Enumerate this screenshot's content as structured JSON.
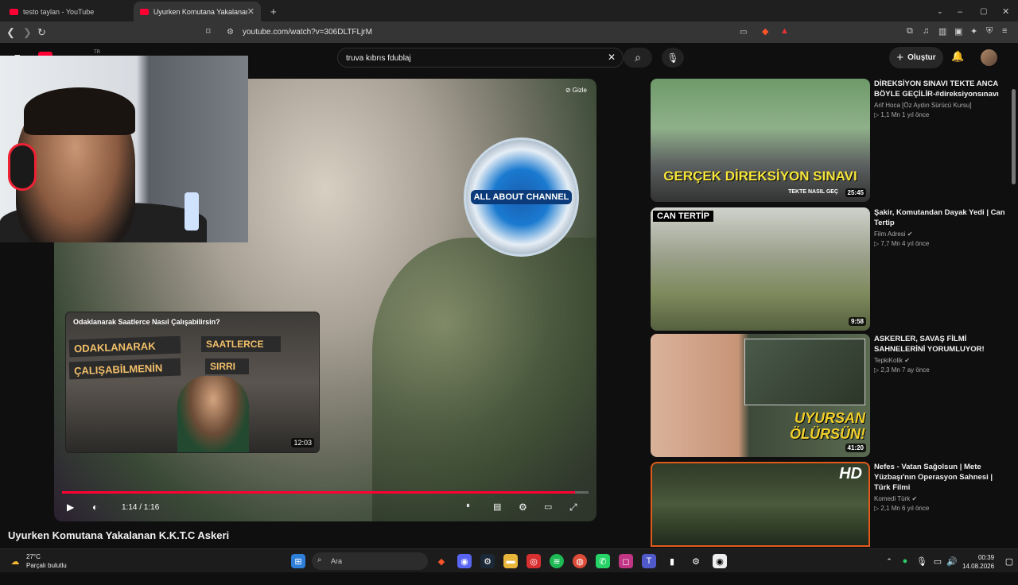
{
  "browser": {
    "tabs": [
      {
        "label": "testo taylan - YouTube"
      },
      {
        "label": "Uyurken Komutana Yakalanan K"
      }
    ],
    "new_tab_icon": "plus-icon",
    "url": "youtube.com/watch?v=306DLTFLjrM"
  },
  "header": {
    "search_value": "truva kıbrıs fdublaj",
    "create_label": "Oluştur",
    "logo_badge": "TR"
  },
  "player": {
    "hide_label": "Gizle",
    "channel_logo_text": "ALL ABOUT CHANNEL",
    "time": "1:14 / 1:16",
    "progress_fraction": 0.974,
    "endcard": {
      "title": "Odaklanarak Saatlerce Nasıl Çalışabilirsin?",
      "duration": "12:03",
      "overlay_lines": [
        "ODAKLANARAK",
        "ÇALIŞABİLMENİN",
        "SAATLERCE",
        "SIRRI"
      ]
    }
  },
  "video_title": "Uyurken Komutana Yakalanan K.K.T.C Askeri",
  "recommendations": [
    {
      "title": "DİREKSİYON SINAVI TEKTE ANCA BÖYLE GEÇİLİR-#direksiyonsınavı",
      "channel": "Arif Hoca [Öz Aydın Sürücü Kursu]",
      "stats": "▷ 1,1 Mn   1 yıl önce",
      "duration": "25:45",
      "overlay": "GERÇEK DİREKSİYON SINAVI",
      "overlay_sub": "TEKTE NASIL GEÇ"
    },
    {
      "title": "Şakir, Komutandan Dayak Yedi | Can Tertip",
      "channel": "Film Adresi",
      "stats": "▷ 7,7 Mn   4 yıl önce",
      "duration": "9:58",
      "overlay": "CAN TERTİP"
    },
    {
      "title": "ASKERLER, SAVAŞ FİLMİ SAHNELERİNİ YORUMLUYOR!",
      "channel": "TepkiKolik",
      "stats": "▷ 2,3 Mn   7 ay önce",
      "duration": "41:20",
      "overlay": "UYURSAN ÖLÜRSÜN!"
    },
    {
      "title": "Nefes - Vatan Sağolsun | Mete Yüzbaşı'nın Operasyon Sahnesi | Türk Filmi",
      "channel": "Komedi Türk",
      "stats": "▷ 2,1 Mn   6 yıl önce",
      "duration": "",
      "overlay": "HD"
    }
  ],
  "taskbar": {
    "weather_temp": "27°C",
    "weather_desc": "Parçalı bulutlu",
    "search_label": "Ara",
    "time": "00:39",
    "date": "14.08.2026"
  },
  "colors": {
    "accent": "#ff0033",
    "background": "#0f0f0f"
  }
}
